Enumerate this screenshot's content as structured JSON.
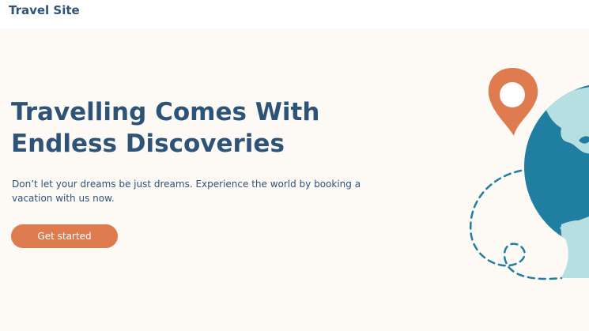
{
  "header": {
    "brand": "Travel Site"
  },
  "hero": {
    "headline_line1": "Travelling Comes With",
    "headline_line2": "Endless Discoveries",
    "subtext_line1": "Don’t let your dreams be just dreams. Experience the world by booking a",
    "subtext_line2": "vacation with us now.",
    "cta_label": "Get started"
  },
  "colors": {
    "primary_text": "#2e5378",
    "accent": "#de7b4f",
    "hero_background": "#fdf9f5",
    "globe_ocean": "#207ea0",
    "globe_land": "#b5dfe0"
  },
  "icons": {
    "pin": "map-pin-icon",
    "globe": "globe-illustration"
  }
}
